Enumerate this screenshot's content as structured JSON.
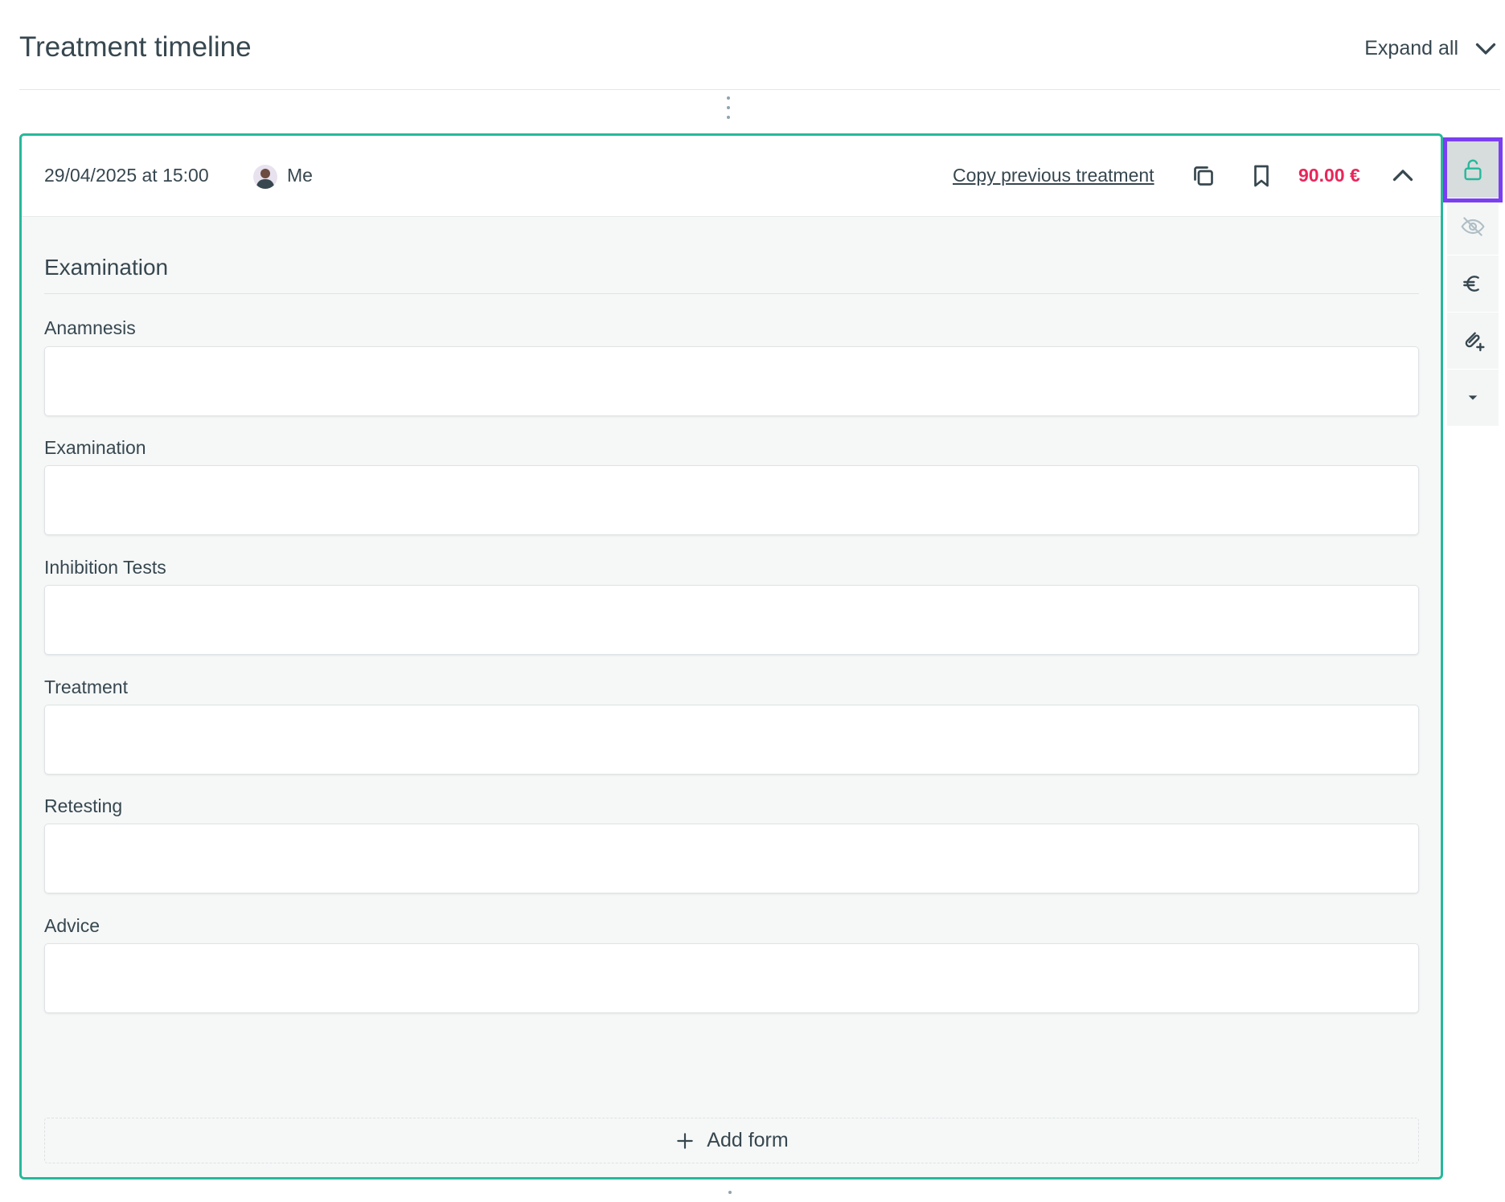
{
  "header": {
    "title": "Treatment timeline",
    "expand_label": "Expand all"
  },
  "entry": {
    "datetime": "29/04/2025 at 15:00",
    "user": "Me",
    "copy_label": "Copy previous treatment",
    "price": "90.00 €",
    "section_title": "Examination",
    "fields": [
      {
        "label": "Anamnesis",
        "value": ""
      },
      {
        "label": "Examination",
        "value": ""
      },
      {
        "label": "Inhibition Tests",
        "value": ""
      },
      {
        "label": "Treatment",
        "value": ""
      },
      {
        "label": "Retesting",
        "value": ""
      },
      {
        "label": "Advice",
        "value": ""
      }
    ],
    "add_form_label": "Add form"
  },
  "side_toolbar": [
    {
      "icon": "lock-open-icon",
      "active": true
    },
    {
      "icon": "eye-off-icon",
      "active": false
    },
    {
      "icon": "euro-icon",
      "active": false
    },
    {
      "icon": "attach-add-icon",
      "active": false
    },
    {
      "icon": "caret-down-icon",
      "active": false
    }
  ],
  "colors": {
    "accent": "#26b89b",
    "price": "#e8265a",
    "highlight": "#7b3ff2",
    "text": "#37474f"
  }
}
